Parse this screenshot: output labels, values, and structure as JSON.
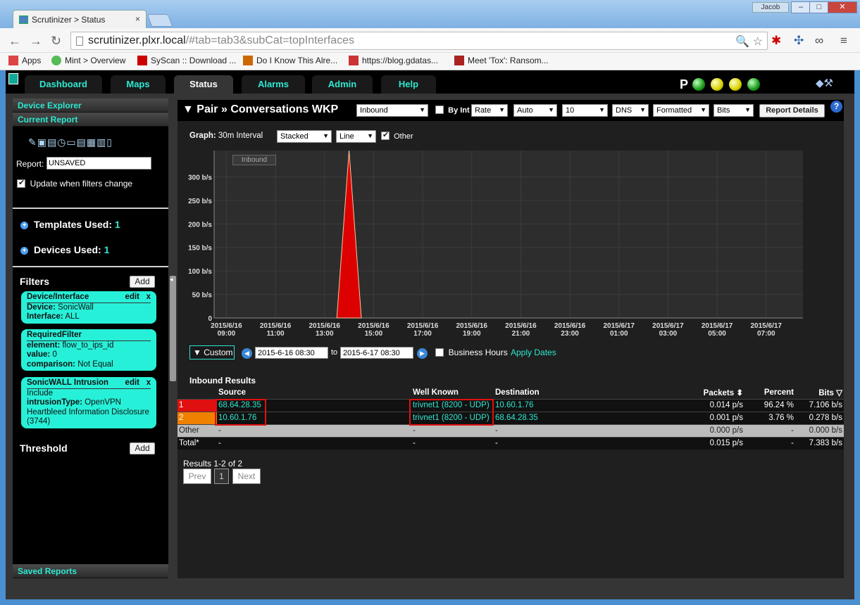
{
  "browser": {
    "tab_title": "Scrutinizer > Status",
    "tab_close": "×",
    "user": "Jacob",
    "url_host": "scrutinizer.plxr.local",
    "url_path": "/#tab=tab3&subCat=topInterfaces",
    "bookmarks": [
      {
        "label": "Apps",
        "color": "#d44"
      },
      {
        "label": "Mint > Overview",
        "color": "#5b5"
      },
      {
        "label": "SyScan :: Download ...",
        "color": "#c00"
      },
      {
        "label": "Do I Know This Alre...",
        "color": "#c60"
      },
      {
        "label": "https://blog.gdatas...",
        "color": "#c33"
      },
      {
        "label": "Meet 'Tox': Ransom...",
        "color": "#a22"
      }
    ]
  },
  "nav": {
    "tabs": [
      {
        "label": "Dashboard"
      },
      {
        "label": "Maps"
      },
      {
        "label": "Status"
      },
      {
        "label": "Alarms"
      },
      {
        "label": "Admin"
      },
      {
        "label": "Help"
      }
    ],
    "status_letter": "P"
  },
  "sidebar": {
    "device_explorer": "Device Explorer",
    "current_report": "Current Report",
    "report_label": "Report:",
    "report_value": "UNSAVED",
    "update_label": "Update when filters change",
    "templates_label": "Templates Used:",
    "templates_count": "1",
    "devices_label": "Devices Used:",
    "devices_count": "1",
    "filters_title": "Filters",
    "add_label": "Add",
    "edit_label": "edit",
    "remove_label": "x",
    "filter1": {
      "title": "Device/Interface",
      "k1": "Device:",
      "v1": " SonicWall",
      "k2": "Interface:",
      "v2": " ALL"
    },
    "filter2": {
      "title": "RequiredFilter",
      "k1": "element:",
      "v1": " flow_to_ips_id",
      "k2": "value:",
      "v2": " 0",
      "k3": "comparison:",
      "v3": " Not Equal"
    },
    "filter3": {
      "title": "SonicWALL Intrusion",
      "line1": "Include",
      "k2": "intrusionType:",
      "v2": " OpenVPN Heartbleed Information Disclosure (3744)"
    },
    "threshold_title": "Threshold",
    "saved_reports": "Saved Reports"
  },
  "main": {
    "title": "▼ Pair » Conversations WKP",
    "direction": "Inbound",
    "by_int": "By Int",
    "rate": "Rate",
    "auto": "Auto",
    "top_n": "10",
    "dns": "DNS",
    "formatted": "Formatted",
    "bits": "Bits",
    "report_details": "Report Details",
    "help": "?",
    "graph_label": "Graph:",
    "interval": "30m Interval",
    "stacked": "Stacked",
    "line": "Line",
    "other_label": "Other",
    "custom": "▼ Custom",
    "start_date": "2015-6-16 08:30",
    "to": "to",
    "end_date": "2015-6-17 08:30",
    "business_hours": "Business Hours",
    "apply_dates": "Apply Dates",
    "results_title": "Inbound Results",
    "paging_info": "Results 1-2 of 2",
    "prev": "Prev",
    "page": "1",
    "next": "Next"
  },
  "table": {
    "headers": {
      "source": "Source",
      "well_known": "Well Known",
      "destination": "Destination",
      "packets": "Packets",
      "percent": "Percent",
      "bits": "Bits"
    },
    "rows": [
      {
        "idx": "1",
        "source": "68.64.28.35",
        "well_known": "trivnet1 (8200 - UDP)",
        "destination": "10.60.1.76",
        "packets": "0.014 p/s",
        "percent": "96.24 %",
        "bits": "7.106 b/s"
      },
      {
        "idx": "2",
        "source": "10.60.1.76",
        "well_known": "trivnet1 (8200 - UDP)",
        "destination": "68.64.28.35",
        "packets": "0.001 p/s",
        "percent": "3.76 %",
        "bits": "0.278 b/s"
      }
    ],
    "other": {
      "label": "Other",
      "source": "-",
      "well_known": "-",
      "destination": "-",
      "packets": "0.000 p/s",
      "percent": "-",
      "bits": "0.000 b/s"
    },
    "total": {
      "label": "Total*",
      "source": "-",
      "well_known": "-",
      "destination": "-",
      "packets": "0.015 p/s",
      "percent": "-",
      "bits": "7.383 b/s"
    }
  },
  "chart_data": {
    "type": "area",
    "legend": [
      "Inbound"
    ],
    "y_ticks": [
      "300 b/s",
      "250 b/s",
      "200 b/s",
      "150 b/s",
      "100 b/s",
      "50 b/s",
      "0"
    ],
    "ylim": [
      0,
      356
    ],
    "x_ticks": [
      "2015/6/16 09:00",
      "2015/6/16 11:00",
      "2015/6/16 13:00",
      "2015/6/16 15:00",
      "2015/6/16 17:00",
      "2015/6/16 19:00",
      "2015/6/16 21:00",
      "2015/6/16 23:00",
      "2015/6/17 01:00",
      "2015/6/17 03:00",
      "2015/6/17 05:00",
      "2015/6/17 07:00"
    ],
    "series": [
      {
        "name": "Inbound",
        "color": "#dd0000",
        "points": [
          [
            "2015/6/16 13:30",
            0
          ],
          [
            "2015/6/16 14:00",
            356
          ],
          [
            "2015/6/16 14:30",
            0
          ]
        ]
      }
    ]
  }
}
